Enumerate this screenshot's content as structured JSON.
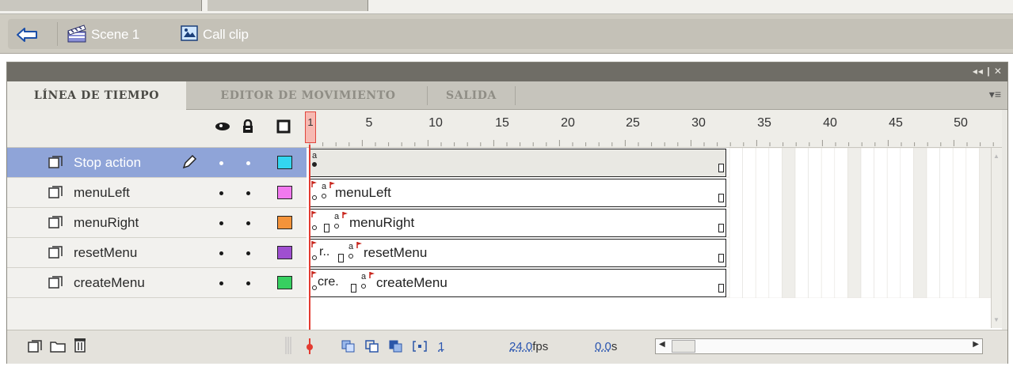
{
  "breadcrumb": {
    "scene_label": "Scene 1",
    "clip_label": "Call clip",
    "icons": [
      "back-arrow-icon",
      "scene-clapboard-icon",
      "movie-clip-icon"
    ]
  },
  "panel": {
    "window_controls": "◂◂ | ✕",
    "tabs": [
      {
        "label": "LÍNEA DE TIEMPO",
        "active": true
      },
      {
        "label": "EDITOR DE MOVIMIENTO",
        "active": false
      },
      {
        "label": "SALIDA",
        "active": false
      }
    ],
    "tab_menu_glyph": "▾≡"
  },
  "timeline": {
    "header_icons": [
      "eye-icon",
      "lock-icon",
      "outline-icon"
    ],
    "playhead_frame_label": "1",
    "ruler_labels": [
      "5",
      "10",
      "15",
      "20",
      "25",
      "30",
      "35",
      "40",
      "45",
      "50"
    ],
    "layers": [
      {
        "name": "Stop action",
        "selected": true,
        "color": "#33d6f0",
        "frame_label": ""
      },
      {
        "name": "menuLeft",
        "selected": false,
        "color": "#f279ef",
        "frame_label": "menuLeft"
      },
      {
        "name": "menuRight",
        "selected": false,
        "color": "#f4933a",
        "frame_label": "menuRight"
      },
      {
        "name": "resetMenu",
        "selected": false,
        "color": "#9f4fd0",
        "frame_label": "resetMenu",
        "short_label": "r.."
      },
      {
        "name": "createMenu",
        "selected": false,
        "color": "#37d060",
        "frame_label": "createMenu",
        "short_label": "cre."
      }
    ]
  },
  "status_bar": {
    "current_frame": "1",
    "fps_value": "24.0",
    "fps_unit": "fps",
    "time_value": "0.0",
    "time_unit": "s"
  },
  "colors": {
    "selected_row": "#8fa4d8",
    "playhead": "#e33b31",
    "panel_title": "#6f6d66"
  }
}
